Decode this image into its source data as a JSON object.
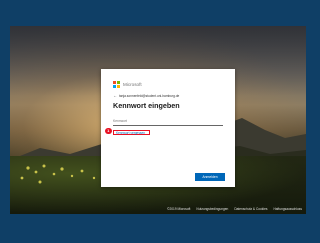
{
  "brand": {
    "name": "Microsoft",
    "colors": {
      "red": "#f25022",
      "green": "#7fba00",
      "blue": "#00a4ef",
      "yellow": "#ffb900"
    }
  },
  "identity": {
    "back_icon": "arrow-left-icon",
    "email": "tanja.sonnenfeld@student.uni-hamburg.de"
  },
  "heading": "Kennwort eingeben",
  "password": {
    "value": "",
    "placeholder": "Kennwort"
  },
  "forgot_link": "Kennwort vergessen",
  "step_marker": "1",
  "signin_button": "Anmelden",
  "accent_color": "#0067b8",
  "highlight_color": "#e81123",
  "footer": {
    "links": [
      "©2019 Microsoft",
      "Nutzungsbedingungen",
      "Datenschutz & Cookies",
      "Haftungsausschluss"
    ]
  }
}
